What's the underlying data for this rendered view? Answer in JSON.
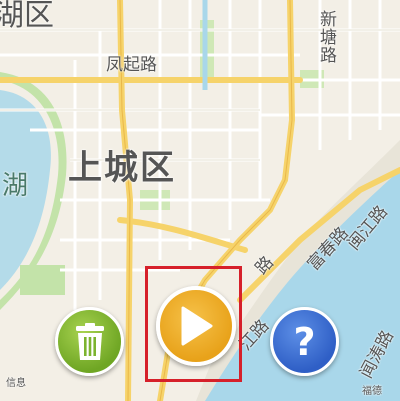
{
  "map": {
    "labels": {
      "district_top": "湖区",
      "fengqi_road": "凤起路",
      "xintang_road": "新塘路",
      "shangcheng": "上城区",
      "lake": "湖",
      "fuchun_road": "富春路",
      "mid_road": "路",
      "jiang_road": "江路",
      "minjiang_road": "闽江路",
      "yanjiang_road": "闻涛路",
      "bottom_left": "信息",
      "bottom_right": "福德"
    }
  },
  "controls": {
    "delete_icon": "trash-icon",
    "play_icon": "play-icon",
    "help_icon": "question-icon",
    "help_glyph": "?"
  },
  "colors": {
    "trash_green": "#7cb32f",
    "play_orange": "#eea823",
    "help_blue": "#3b6fd6",
    "highlight_red": "#d6202a",
    "water": "#a9d7ea",
    "park": "#bfe0a2"
  }
}
